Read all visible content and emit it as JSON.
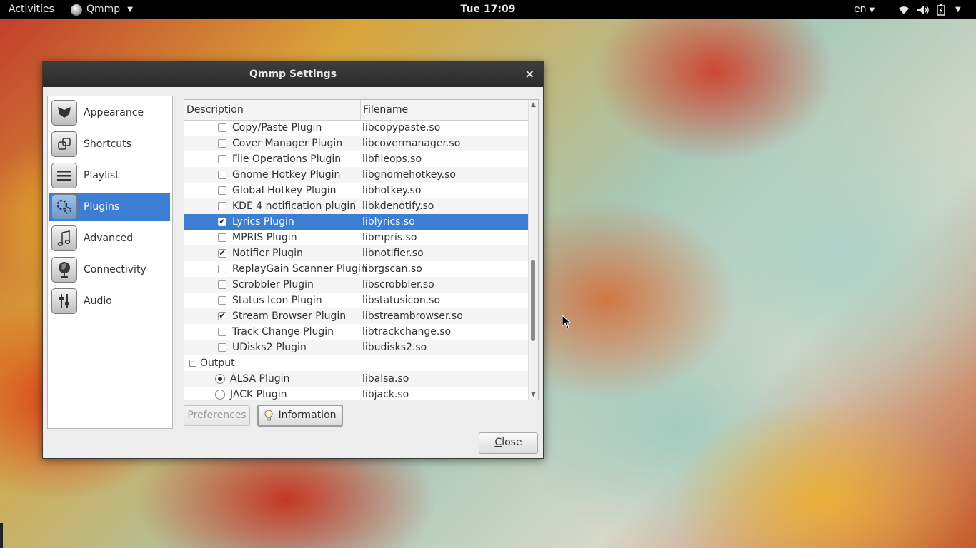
{
  "topbar": {
    "activities": "Activities",
    "app_name": "Qmmp",
    "clock": "Tue 17:09",
    "language": "en"
  },
  "dialog": {
    "title": "Qmmp Settings",
    "close_glyph": "×"
  },
  "sidebar": {
    "items": [
      {
        "label": "Appearance",
        "icon": "butterfly-icon",
        "selected": false
      },
      {
        "label": "Shortcuts",
        "icon": "shortcuts-icon",
        "selected": false
      },
      {
        "label": "Playlist",
        "icon": "playlist-icon",
        "selected": false
      },
      {
        "label": "Plugins",
        "icon": "gears-icon",
        "selected": true
      },
      {
        "label": "Advanced",
        "icon": "music-note-icon",
        "selected": false
      },
      {
        "label": "Connectivity",
        "icon": "globe-icon",
        "selected": false
      },
      {
        "label": "Audio",
        "icon": "equalizer-icon",
        "selected": false
      }
    ]
  },
  "plugins_table": {
    "headers": {
      "description": "Description",
      "filename": "Filename"
    },
    "rows": [
      {
        "description": "Copy/Paste Plugin",
        "filename": "libcopypaste.so",
        "checked": false
      },
      {
        "description": "Cover Manager Plugin",
        "filename": "libcovermanager.so",
        "checked": false
      },
      {
        "description": "File Operations Plugin",
        "filename": "libfileops.so",
        "checked": false
      },
      {
        "description": "Gnome Hotkey Plugin",
        "filename": "libgnomehotkey.so",
        "checked": false
      },
      {
        "description": "Global Hotkey Plugin",
        "filename": "libhotkey.so",
        "checked": false
      },
      {
        "description": "KDE 4 notification plugin",
        "filename": "libkdenotify.so",
        "checked": false
      },
      {
        "description": "Lyrics Plugin",
        "filename": "liblyrics.so",
        "checked": true,
        "selected": true
      },
      {
        "description": "MPRIS Plugin",
        "filename": "libmpris.so",
        "checked": false
      },
      {
        "description": "Notifier Plugin",
        "filename": "libnotifier.so",
        "checked": true
      },
      {
        "description": "ReplayGain Scanner Plugin",
        "filename": "librgscan.so",
        "checked": false
      },
      {
        "description": "Scrobbler Plugin",
        "filename": "libscrobbler.so",
        "checked": false
      },
      {
        "description": "Status Icon Plugin",
        "filename": "libstatusicon.so",
        "checked": false
      },
      {
        "description": "Stream Browser Plugin",
        "filename": "libstreambrowser.so",
        "checked": true
      },
      {
        "description": "Track Change Plugin",
        "filename": "libtrackchange.so",
        "checked": false
      },
      {
        "description": "UDisks2 Plugin",
        "filename": "libudisks2.so",
        "checked": false
      }
    ],
    "output_category": {
      "label": "Output",
      "expander": "−",
      "items": [
        {
          "description": "ALSA Plugin",
          "filename": "libalsa.so",
          "selected": true
        },
        {
          "description": "JACK Plugin",
          "filename": "libjack.so",
          "selected": false
        }
      ]
    }
  },
  "buttons": {
    "preferences": "Preferences",
    "information": "Information",
    "close": "Close"
  },
  "colors": {
    "selection": "#3b7ed3",
    "topbar": "#000000",
    "titlebar": "#2f2f2f"
  }
}
